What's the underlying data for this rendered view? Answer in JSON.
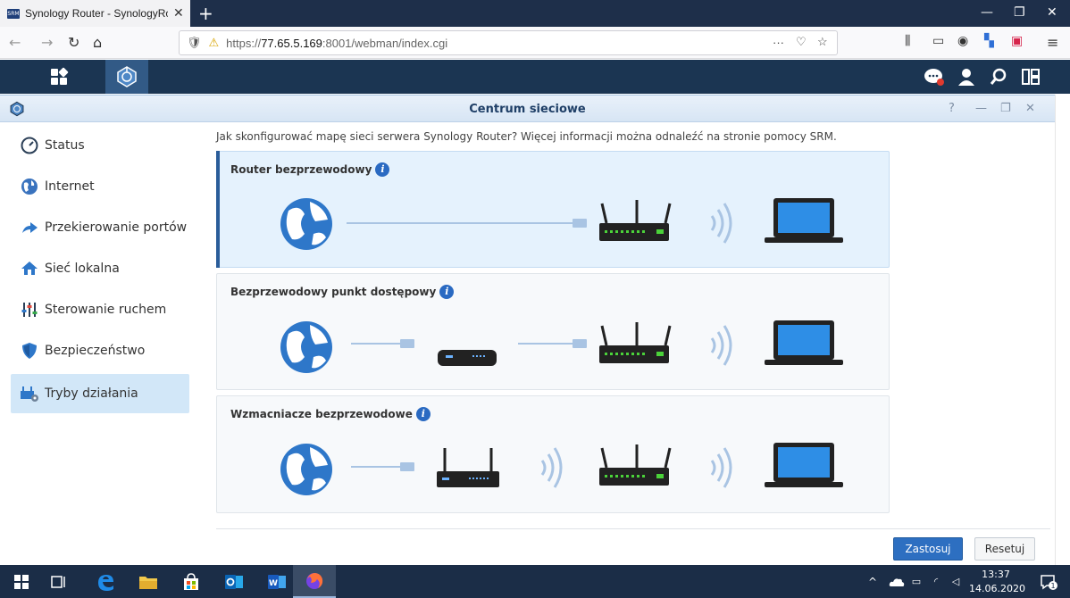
{
  "browser": {
    "tab_title": "Synology Router - SynologyRo",
    "favicon_text": "SRM",
    "url_prefix": "https://",
    "url_host": "77.65.5.169",
    "url_rest": ":8001/webman/index.cgi",
    "more_label": "···"
  },
  "window": {
    "title": "Centrum sieciowe"
  },
  "sidebar": {
    "items": [
      {
        "label": "Status",
        "icon": "gauge-icon"
      },
      {
        "label": "Internet",
        "icon": "globe-icon"
      },
      {
        "label": "Przekierowanie portów",
        "icon": "arrow-icon"
      },
      {
        "label": "Sieć lokalna",
        "icon": "home-icon"
      },
      {
        "label": "Sterowanie ruchem",
        "icon": "sliders-icon"
      },
      {
        "label": "Bezpieczeństwo",
        "icon": "shield-icon"
      },
      {
        "label": "Tryby działania",
        "icon": "modes-icon"
      }
    ],
    "active_index": 6
  },
  "main": {
    "intro": "Jak skonfigurować mapę sieci serwera Synology Router? Więcej informacji można odnaleźć na stronie pomocy SRM.",
    "cards": [
      {
        "title": "Router bezprzewodowy",
        "selected": true
      },
      {
        "title": "Bezprzewodowy punkt dostępowy",
        "selected": false
      },
      {
        "title": "Wzmacniacze bezprzewodowe",
        "selected": false
      }
    ]
  },
  "footer": {
    "apply_label": "Zastosuj",
    "reset_label": "Resetuj"
  },
  "taskbar": {
    "time": "13:37",
    "date": "14.06.2020",
    "notification_count": "1"
  },
  "colors": {
    "srm_bar": "#1b3552",
    "accent": "#2d6fc1",
    "card_selected": "#e5f2fd"
  }
}
